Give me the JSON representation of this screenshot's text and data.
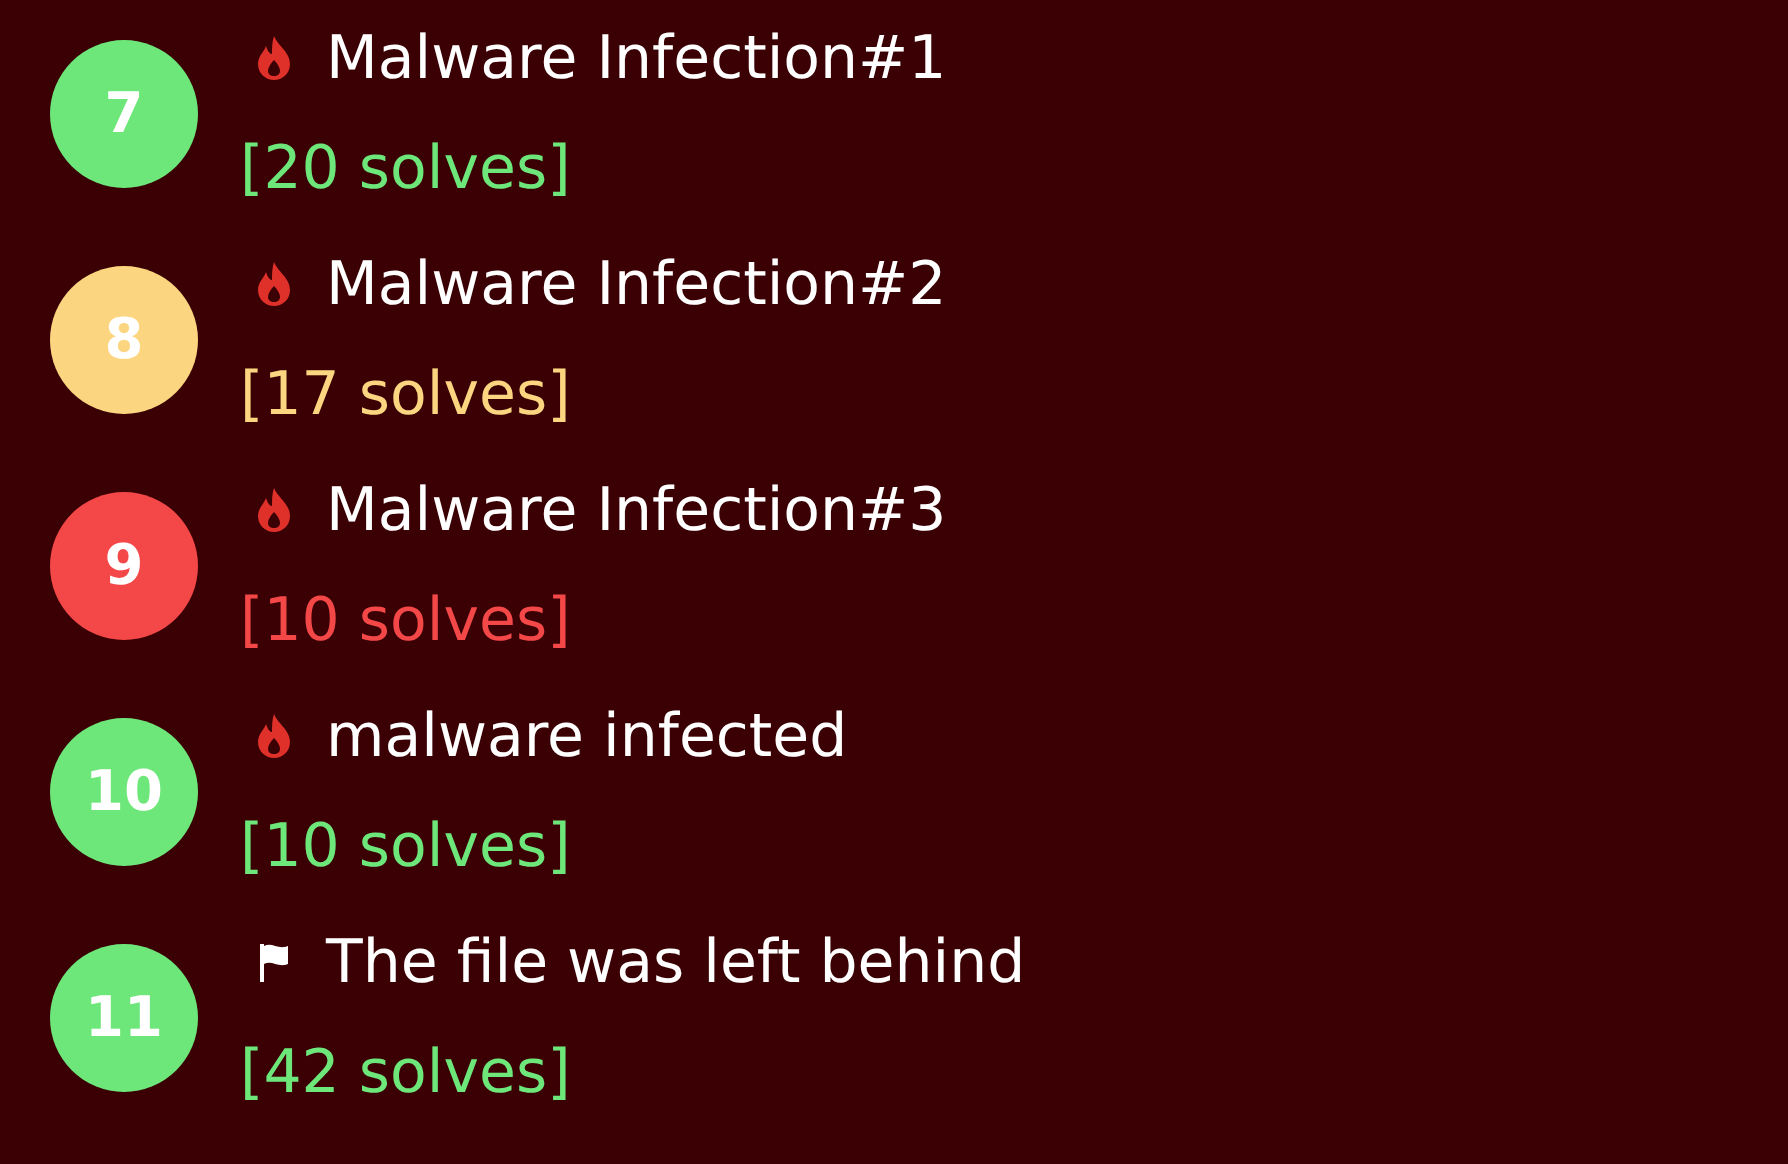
{
  "challenges": [
    {
      "number": "7",
      "color": "#6ee77a",
      "kind": "fire",
      "title": "Malware Infection#1",
      "solves": "[20 solves]"
    },
    {
      "number": "8",
      "color": "#fcd581",
      "kind": "fire",
      "title": "Malware Infection#2",
      "solves": "[17 solves]"
    },
    {
      "number": "9",
      "color": "#f44848",
      "kind": "fire",
      "title": "Malware Infection#3",
      "solves": "[10 solves]"
    },
    {
      "number": "10",
      "color": "#6ee77a",
      "kind": "fire",
      "title": "malware infected",
      "solves": "[10 solves]"
    },
    {
      "number": "11",
      "color": "#6ee77a",
      "kind": "flag",
      "title": "The file was left behind",
      "solves": "[42 solves]"
    }
  ]
}
